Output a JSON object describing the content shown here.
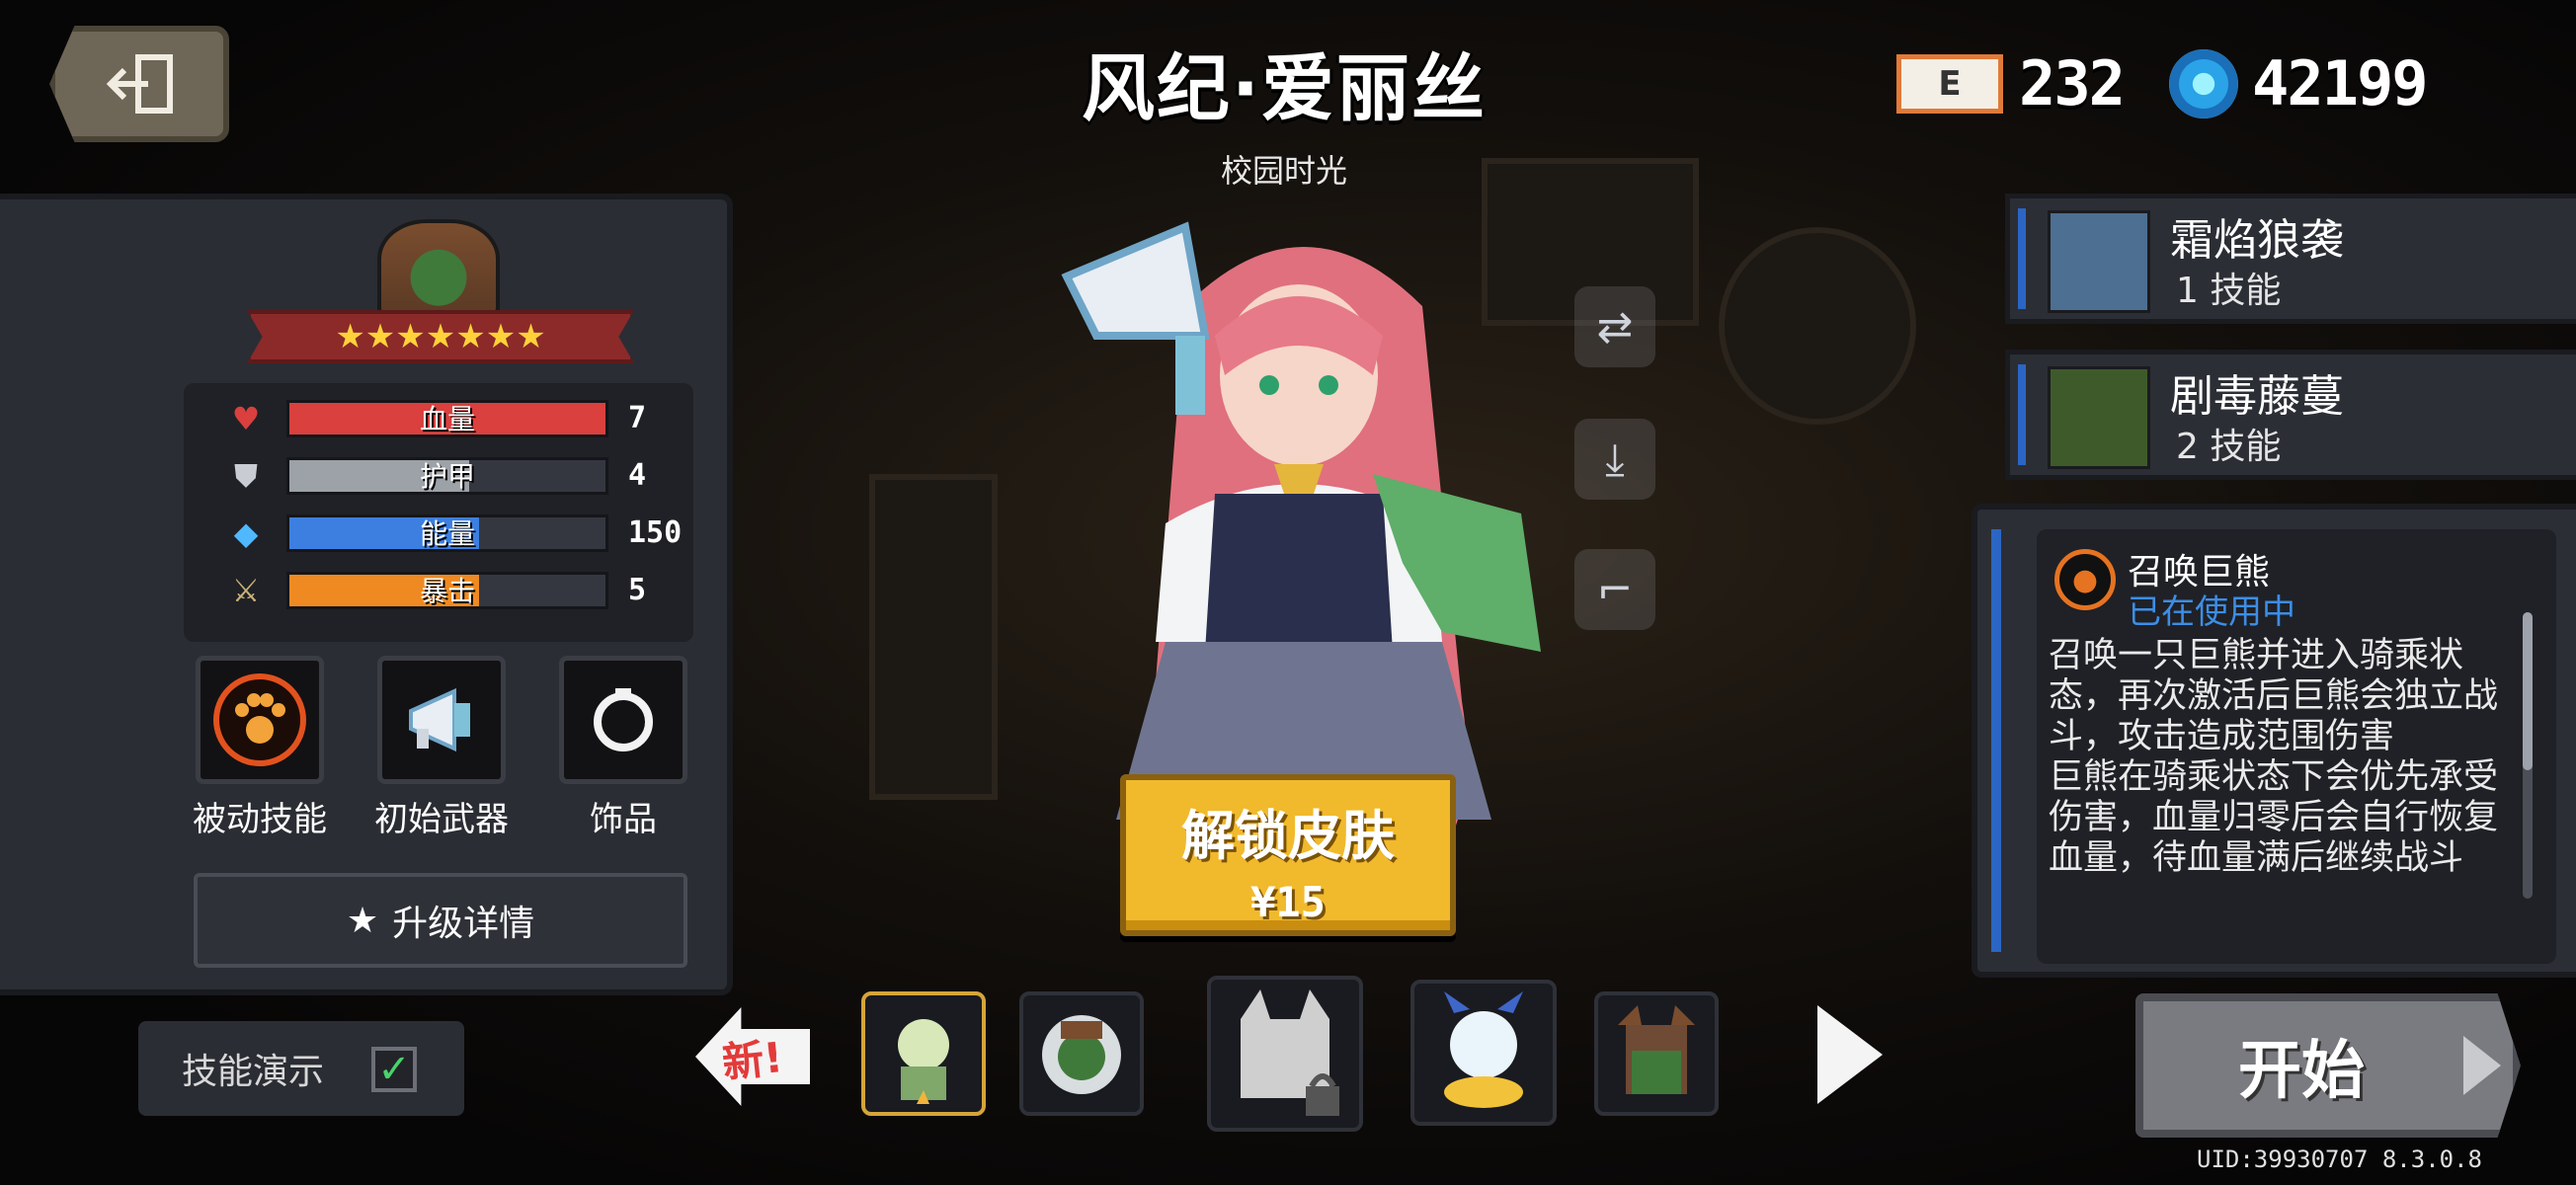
{
  "header": {
    "back_icon": "exit-icon",
    "character_name": "风纪·爱丽丝",
    "skin_name": "校园时光"
  },
  "currency": {
    "ecard_label": "E",
    "ecard_count": "232",
    "gems_count": "42199"
  },
  "stats": {
    "stars": "★★★★★★★",
    "rows": [
      {
        "icon": "heart-icon",
        "label": "血量",
        "value": "7",
        "fill": 1.0,
        "color": "#d9403e"
      },
      {
        "icon": "shield-icon",
        "label": "护甲",
        "value": "4",
        "fill": 0.57,
        "color": "#9da1a8"
      },
      {
        "icon": "energy-icon",
        "label": "能量",
        "value": "150",
        "fill": 0.6,
        "color": "#3c7fe0"
      },
      {
        "icon": "crit-icon",
        "label": "暴击",
        "value": "5",
        "fill": 0.6,
        "color": "#ef8a22"
      }
    ]
  },
  "slots": {
    "passive_label": "被动技能",
    "weapon_label": "初始武器",
    "accessory_label": "饰品"
  },
  "upgrade_label": "升级详情",
  "demo_label": "技能演示",
  "demo_checked": true,
  "unlock": {
    "title": "解锁皮肤",
    "price": "¥15"
  },
  "pets": [
    {
      "name": "霜焰狼袭",
      "level": "1 技能"
    },
    {
      "name": "剧毒藤蔓",
      "level": "2 技能"
    }
  ],
  "skill": {
    "title": "召唤巨熊",
    "status": "已在使用中",
    "description": "召唤一只巨熊并进入骑乘状态，再次激活后巨熊会独立战斗，攻击造成范围伤害\n巨熊在骑乘状态下会优先承受伤害，血量归零后会自行恢复血量，待血量满后继续战斗"
  },
  "bottom": {
    "new_badge": "新!",
    "start_label": "开始",
    "uid": "UID:39930707 8.3.0.8"
  },
  "colors": {
    "accent_blue": "#2b66c4",
    "unlock_gold": "#f1b92c",
    "star_gold": "#ffd23a"
  }
}
